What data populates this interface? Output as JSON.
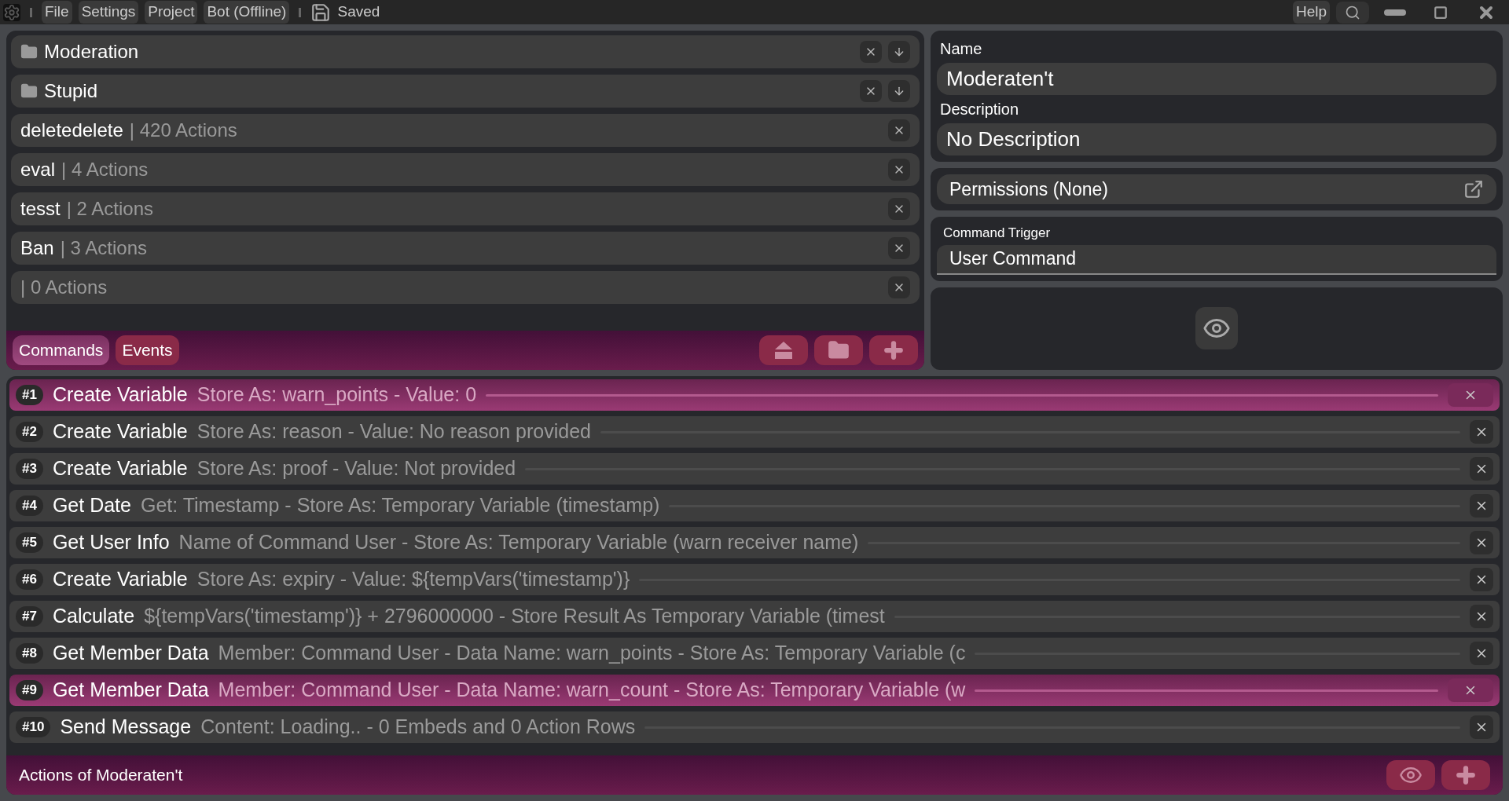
{
  "menu": [
    {
      "label": "File"
    },
    {
      "label": "Settings"
    },
    {
      "label": "Project"
    },
    {
      "label": "Bot (Offline)"
    }
  ],
  "save_status": "Saved",
  "help": "Help",
  "commands": [
    {
      "kind": "folder",
      "name": "Moderation"
    },
    {
      "kind": "folder",
      "name": "Stupid"
    },
    {
      "kind": "command",
      "name": "deletedelete",
      "count": "| 420 Actions"
    },
    {
      "kind": "command",
      "name": "eval",
      "count": "| 4 Actions"
    },
    {
      "kind": "command",
      "name": "tesst",
      "count": "| 2 Actions"
    },
    {
      "kind": "command",
      "name": "Ban",
      "count": "| 3 Actions"
    },
    {
      "kind": "command",
      "count": "| 0 Actions"
    }
  ],
  "tabs": [
    {
      "label": "Commands",
      "selected": true
    },
    {
      "label": "Events",
      "selected": false
    }
  ],
  "details": {
    "name_label": "Name",
    "name": "Moderaten't",
    "description_label": "Description",
    "description": "No Description",
    "permissions": "Permissions (None)",
    "trigger_label": "Command Trigger",
    "trigger": "User Command"
  },
  "actions": [
    {
      "number": "#1",
      "name": "Create Variable",
      "summary": "Store As: warn_points - Value: 0",
      "selected": true
    },
    {
      "number": "#2",
      "name": "Create Variable",
      "summary": "Store As: reason - Value: No reason provided",
      "selected": false
    },
    {
      "number": "#3",
      "name": "Create Variable",
      "summary": "Store As: proof - Value: Not provided",
      "selected": false
    },
    {
      "number": "#4",
      "name": "Get Date",
      "summary": "Get: Timestamp - Store As: Temporary Variable (timestamp)",
      "selected": false
    },
    {
      "number": "#5",
      "name": "Get User Info",
      "summary": "Name of Command User - Store As: Temporary Variable (warn receiver name)",
      "selected": false
    },
    {
      "number": "#6",
      "name": "Create Variable",
      "summary": "Store As: expiry - Value: ${tempVars('timestamp')}",
      "selected": false
    },
    {
      "number": "#7",
      "name": "Calculate",
      "summary": "${tempVars('timestamp')} + 2796000000 - Store Result As Temporary Variable (timest",
      "selected": false
    },
    {
      "number": "#8",
      "name": "Get Member Data",
      "summary": "Member: Command User - Data Name: warn_points - Store As: Temporary Variable (c",
      "selected": false
    },
    {
      "number": "#9",
      "name": "Get Member Data",
      "summary": "Member: Command User - Data Name: warn_count - Store As: Temporary Variable (w",
      "selected": true
    },
    {
      "number": "#10",
      "name": "Send Message",
      "summary": "Content: Loading.. - 0 Embeds and 0 Action Rows",
      "selected": false
    }
  ],
  "actions_title": "Actions of Moderaten't"
}
